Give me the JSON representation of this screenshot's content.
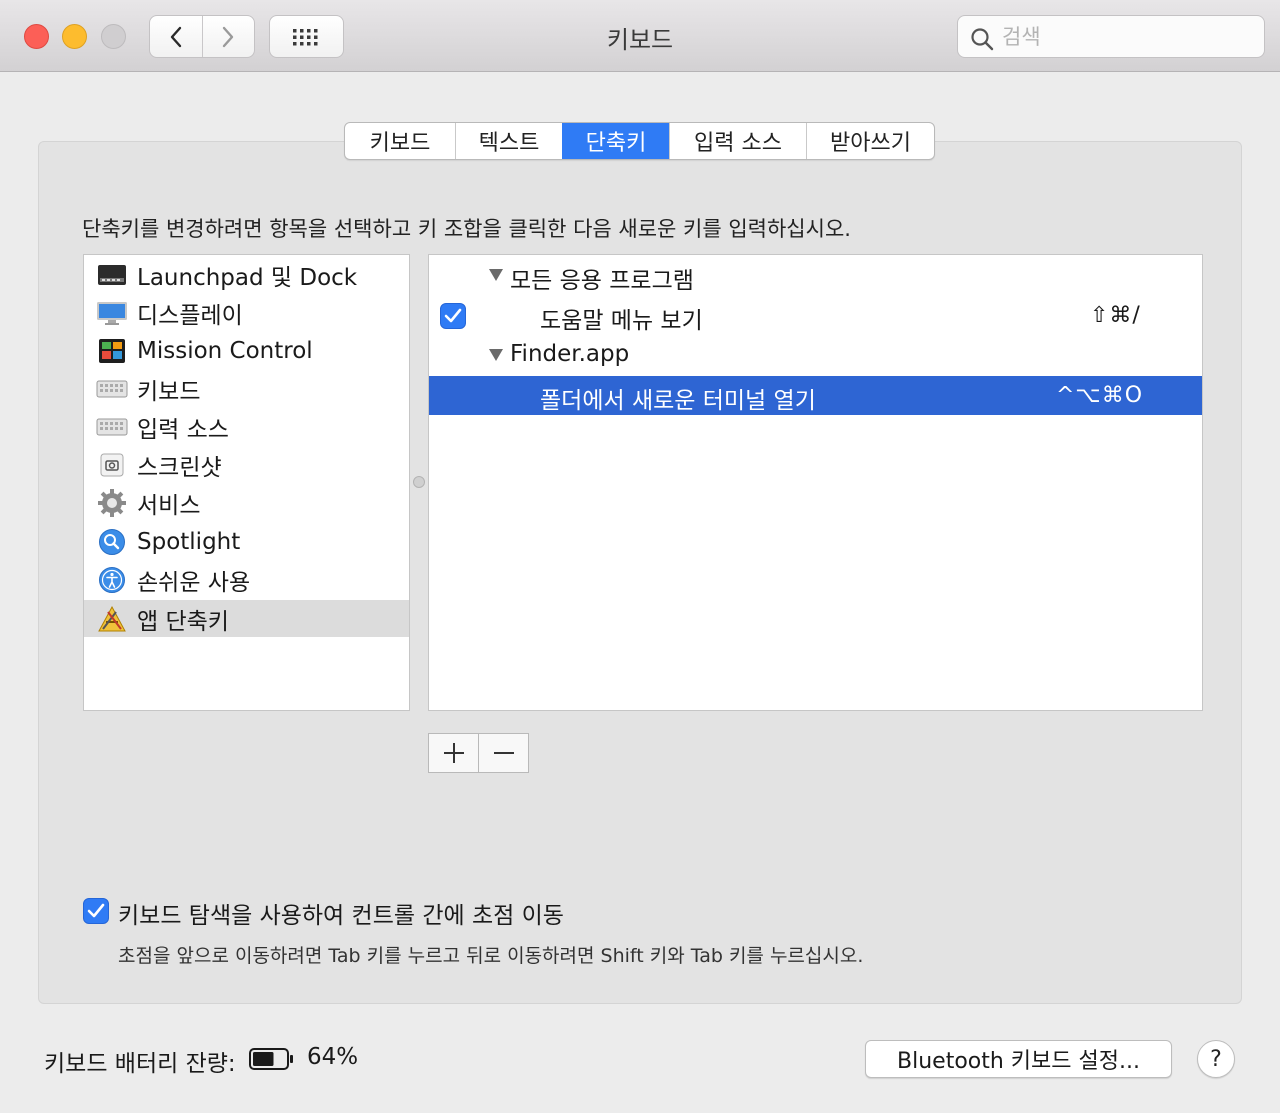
{
  "window": {
    "title": "키보드",
    "search_placeholder": "검색"
  },
  "tabs": [
    {
      "label": "키보드",
      "active": false
    },
    {
      "label": "텍스트",
      "active": false
    },
    {
      "label": "단축키",
      "active": true
    },
    {
      "label": "입력 소스",
      "active": false
    },
    {
      "label": "받아쓰기",
      "active": false
    }
  ],
  "instruction": "단축키를 변경하려면 항목을 선택하고 키 조합을 클릭한 다음 새로운 키를 입력하십시오.",
  "categories": [
    {
      "label": "Launchpad 및 Dock",
      "icon": "launchpad-dock-icon"
    },
    {
      "label": "디스플레이",
      "icon": "display-icon"
    },
    {
      "label": "Mission Control",
      "icon": "mission-control-icon"
    },
    {
      "label": "키보드",
      "icon": "keyboard-icon"
    },
    {
      "label": "입력 소스",
      "icon": "input-source-icon"
    },
    {
      "label": "스크린샷",
      "icon": "screenshot-icon"
    },
    {
      "label": "서비스",
      "icon": "services-gear-icon"
    },
    {
      "label": "Spotlight",
      "icon": "spotlight-icon"
    },
    {
      "label": "손쉬운 사용",
      "icon": "accessibility-icon"
    },
    {
      "label": "앱 단축키",
      "icon": "app-shortcuts-icon",
      "selected": true
    }
  ],
  "shortcuts": [
    {
      "type": "group",
      "label": "모든 응용 프로그램",
      "expanded": true
    },
    {
      "type": "item",
      "label": "도움말 메뉴 보기",
      "keys": "⇧⌘/",
      "checked": true
    },
    {
      "type": "group",
      "label": "Finder.app",
      "expanded": true
    },
    {
      "type": "item",
      "label": "폴더에서 새로운 터미널 열기",
      "keys": "^⌥⌘O",
      "selected": true
    }
  ],
  "buttons": {
    "add": "+",
    "remove": "−",
    "bluetooth": "Bluetooth 키보드 설정...",
    "help": "?"
  },
  "keyboard_navigation": {
    "checked": true,
    "label": "키보드 탐색을 사용하여 컨트롤 간에 초점 이동",
    "hint": "초점을 앞으로 이동하려면 Tab 키를 누르고 뒤로 이동하려면 Shift 키와 Tab 키를 누르십시오."
  },
  "battery": {
    "label": "키보드 배터리 잔량:",
    "percent_text": "64%",
    "level": 0.64
  },
  "colors": {
    "accent": "#2f7bf5",
    "selection": "#2e65d3",
    "close": "#fc5f57",
    "minimize": "#fdbc2e"
  }
}
